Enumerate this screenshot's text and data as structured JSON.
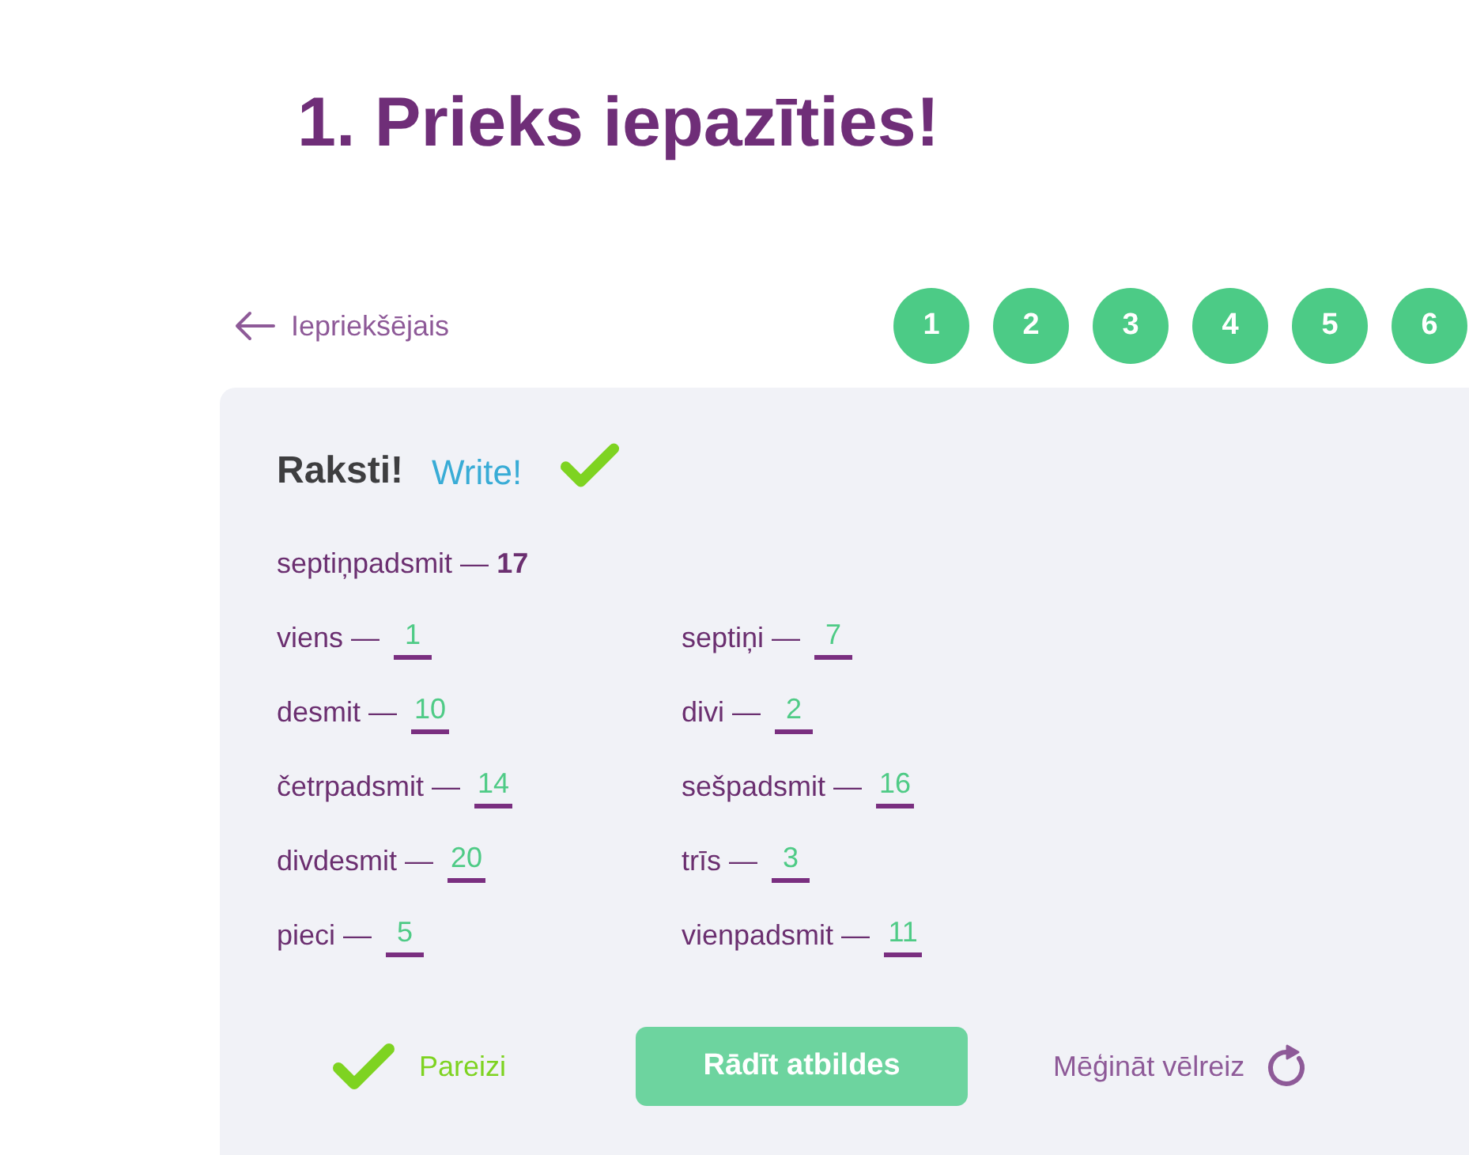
{
  "page": {
    "title": "1. Prieks iepazīties!"
  },
  "navigation": {
    "previous": "Iepriekšējais",
    "pages": [
      {
        "label": "1"
      },
      {
        "label": "2"
      },
      {
        "label": "3"
      },
      {
        "label": "4"
      },
      {
        "label": "5"
      },
      {
        "label": "6"
      }
    ]
  },
  "exercise": {
    "heading": "Raksti!",
    "translation": "Write!",
    "completed": true,
    "example": "septiņpadsmit — **17**",
    "items": [
      {
        "word": "viens —",
        "answer": "1",
        "correct": true
      },
      {
        "word": "septiņi —",
        "answer": "7",
        "correct": true
      },
      {
        "word": "desmit —",
        "answer": "10",
        "correct": true
      },
      {
        "word": "divi —",
        "answer": "2",
        "correct": true
      },
      {
        "word": "četrpadsmit —",
        "answer": "14",
        "correct": true
      },
      {
        "word": "sešpadsmit —",
        "answer": "16",
        "correct": true
      },
      {
        "word": "divdesmit —",
        "answer": "20",
        "correct": true
      },
      {
        "word": "trīs —",
        "answer": "3",
        "correct": true
      },
      {
        "word": "pieci —",
        "answer": "5",
        "correct": true
      },
      {
        "word": "vienpadsmit —",
        "answer": "11",
        "correct": true
      }
    ],
    "result": {
      "correct": true,
      "label": "Pareizi"
    },
    "buttons": {
      "show_answers": "Rādīt atbildes",
      "retry": "Mēģināt vēlreiz"
    }
  }
}
